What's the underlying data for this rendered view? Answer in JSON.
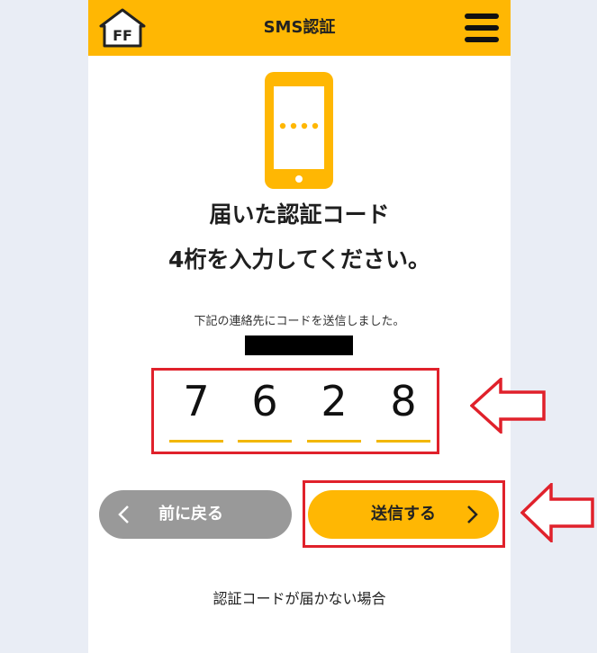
{
  "header": {
    "title": "SMS認証",
    "logo_text": "FF",
    "menu_icon": "hamburger-menu-icon"
  },
  "main": {
    "heading_line1": "届いた認証コード",
    "heading_line2": "4桁を入力してください。",
    "sent_notice": "下記の連絡先にコードを送信しました。",
    "code_digits": [
      "7",
      "6",
      "2",
      "8"
    ]
  },
  "buttons": {
    "back_label": "前に戻る",
    "send_label": "送信する"
  },
  "help_link": "認証コードが届かない場合",
  "colors": {
    "accent": "#ffb703",
    "back_button": "#999999",
    "annotation_red": "#e0212b",
    "underline": "#f2b700"
  }
}
